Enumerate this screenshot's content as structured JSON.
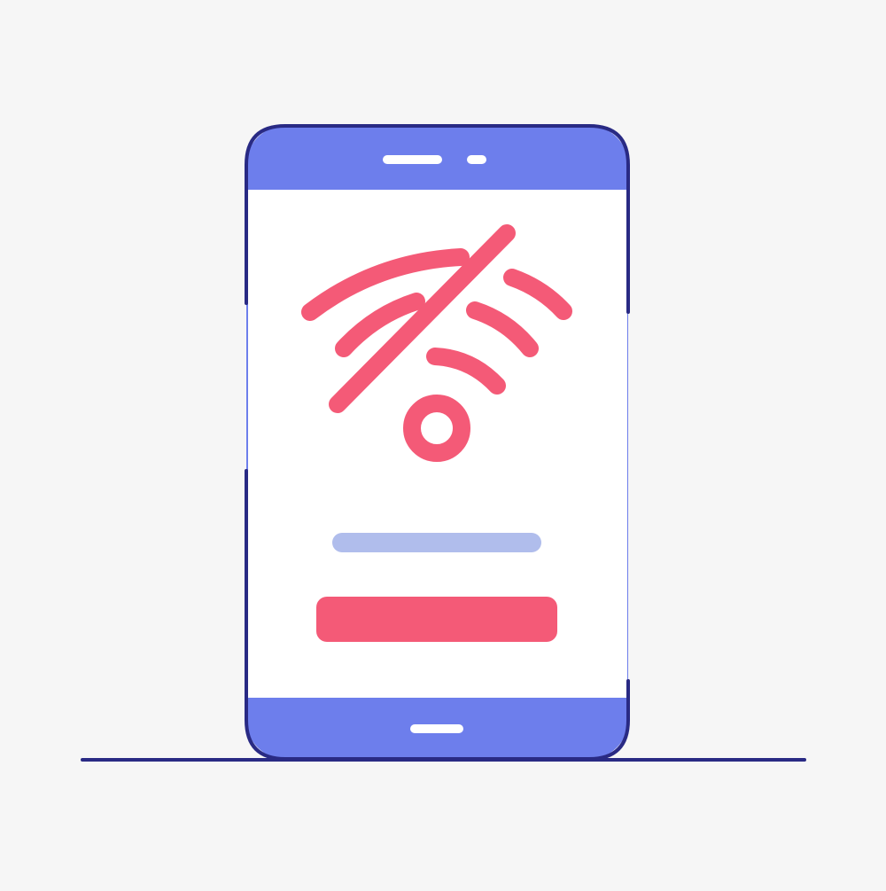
{
  "colors": {
    "background": "#f6f6f6",
    "phone_body": "#6d7eec",
    "phone_outline": "#292a84",
    "screen": "#ffffff",
    "accent": "#f45a77",
    "placeholder_bar": "#b0bdec",
    "ground_line": "#292a84"
  },
  "icons": {
    "status": "wifi-off-icon",
    "speaker": "speaker-grille-icon",
    "camera": "front-camera-icon",
    "home": "home-indicator-icon"
  },
  "labels": {
    "text_line": "",
    "button": ""
  }
}
